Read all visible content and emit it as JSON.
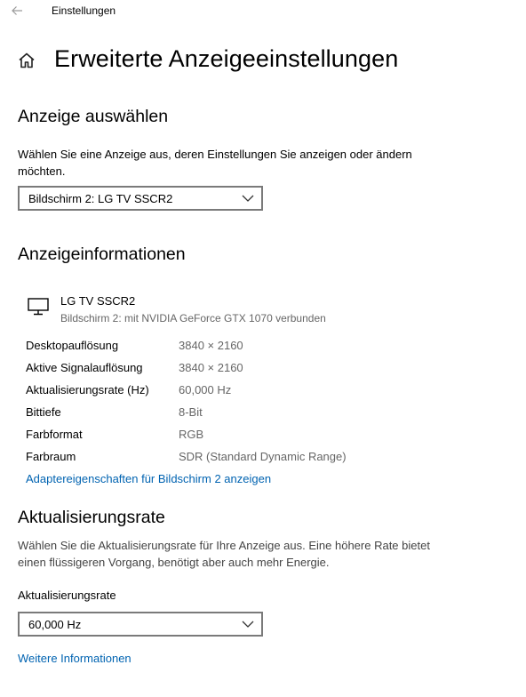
{
  "window": {
    "title": "Einstellungen",
    "back_icon": "arrow-left-icon"
  },
  "page": {
    "title": "Erweiterte Anzeigeeinstellungen",
    "home_icon": "home-icon"
  },
  "select_display": {
    "heading": "Anzeige auswählen",
    "description": "Wählen Sie eine Anzeige aus, deren Einstellungen Sie anzeigen oder ändern möchten.",
    "dropdown_value": "Bildschirm 2: LG TV SSCR2"
  },
  "display_info": {
    "heading": "Anzeigeinformationen",
    "monitor_icon": "monitor-icon",
    "monitor_name": "LG TV SSCR2",
    "monitor_sub": "Bildschirm 2: mit NVIDIA GeForce GTX 1070 verbunden",
    "rows": [
      {
        "key": "Desktopauflösung",
        "value": "3840 × 2160"
      },
      {
        "key": "Aktive Signalauflösung",
        "value": "3840 × 2160"
      },
      {
        "key": "Aktualisierungsrate (Hz)",
        "value": "60,000 Hz"
      },
      {
        "key": "Bittiefe",
        "value": "8-Bit"
      },
      {
        "key": "Farbformat",
        "value": "RGB"
      },
      {
        "key": "Farbraum",
        "value": "SDR (Standard Dynamic Range)"
      }
    ],
    "adapter_link": "Adaptereigenschaften für Bildschirm 2 anzeigen"
  },
  "refresh_rate": {
    "heading": "Aktualisierungsrate",
    "description": "Wählen Sie die Aktualisierungsrate für Ihre Anzeige aus. Eine höhere Rate bietet einen flüssigeren Vorgang, benötigt aber auch mehr Energie.",
    "label": "Aktualisierungsrate",
    "dropdown_value": "60,000 Hz",
    "more_link": "Weitere Informationen"
  },
  "colors": {
    "accent": "#0063b1",
    "secondary_text": "#666666",
    "border": "#7a7a7a"
  }
}
